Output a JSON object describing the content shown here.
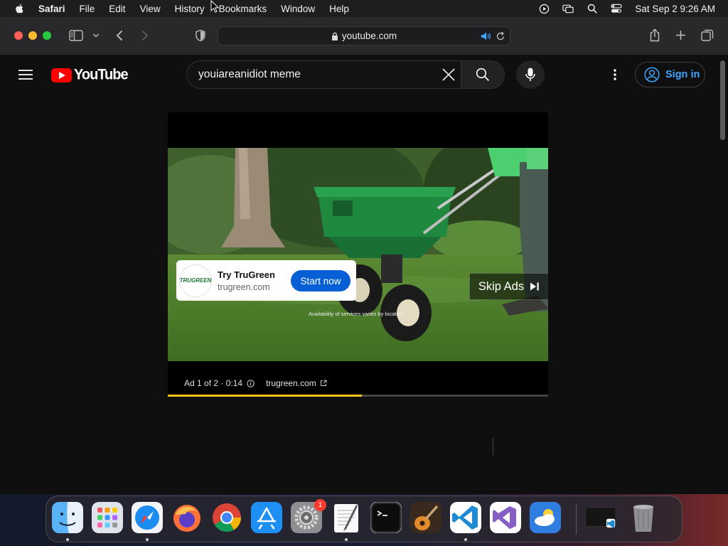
{
  "menubar": {
    "app_name": "Safari",
    "menus": [
      "File",
      "Edit",
      "View",
      "History",
      "Bookmarks",
      "Window",
      "Help"
    ],
    "clock": "Sat Sep 2  9:26 AM",
    "status_icons": [
      "play-circle-icon",
      "screen-mirroring-icon",
      "spotlight-search-icon",
      "control-center-icon"
    ]
  },
  "browser": {
    "url": "youtube.com",
    "icons": [
      "sidebar-icon",
      "chevron-down-icon",
      "back-arrow-icon",
      "forward-arrow-icon",
      "privacy-shield-icon",
      "lock-icon",
      "speaker-icon",
      "reload-icon",
      "share-icon",
      "new-tab-icon",
      "tab-overview-icon"
    ]
  },
  "youtube": {
    "logo_text": "YouTube",
    "search": {
      "query": "youiareanidiot meme"
    },
    "signin_label": "Sign in",
    "accent": "#3ea6ff",
    "brand_red": "#ff0000"
  },
  "ad": {
    "brand_logo_text": "TRUGREEN",
    "title": "Try TruGreen",
    "domain": "trugreen.com",
    "cta_label": "Start now",
    "skip_label": "Skip Ads",
    "disclaimer": "Availability of services varies by location.",
    "counter": "Ad 1 of 2 · 0:14",
    "advertiser_link": "trugreen.com",
    "progress_fraction": 0.51,
    "progress_color": "#f5c518",
    "cta_color": "#065fd4"
  },
  "dock": {
    "apps": [
      {
        "name": "finder",
        "icon": "finder-icon",
        "running": true
      },
      {
        "name": "launchpad",
        "icon": "launchpad-icon",
        "running": false
      },
      {
        "name": "safari",
        "icon": "safari-icon",
        "running": true
      },
      {
        "name": "firefox",
        "icon": "firefox-icon",
        "running": false
      },
      {
        "name": "chrome",
        "icon": "chrome-icon",
        "running": false
      },
      {
        "name": "app-store",
        "icon": "app-store-icon",
        "running": false
      },
      {
        "name": "system-settings",
        "icon": "gear-icon",
        "running": false
      },
      {
        "name": "textedit",
        "icon": "textedit-icon",
        "running": true
      },
      {
        "name": "terminal",
        "icon": "terminal-icon",
        "running": false
      },
      {
        "name": "garageband",
        "icon": "guitar-icon",
        "running": false
      },
      {
        "name": "vscode",
        "icon": "vscode-icon",
        "running": true
      },
      {
        "name": "visual-studio",
        "icon": "visual-studio-icon",
        "running": false
      },
      {
        "name": "weather",
        "icon": "weather-icon",
        "running": false
      },
      {
        "name": "minimized-window",
        "icon": "window-thumbnail-icon",
        "running": false
      },
      {
        "name": "trash",
        "icon": "trash-icon",
        "running": false
      }
    ],
    "settings_badge": "1"
  }
}
